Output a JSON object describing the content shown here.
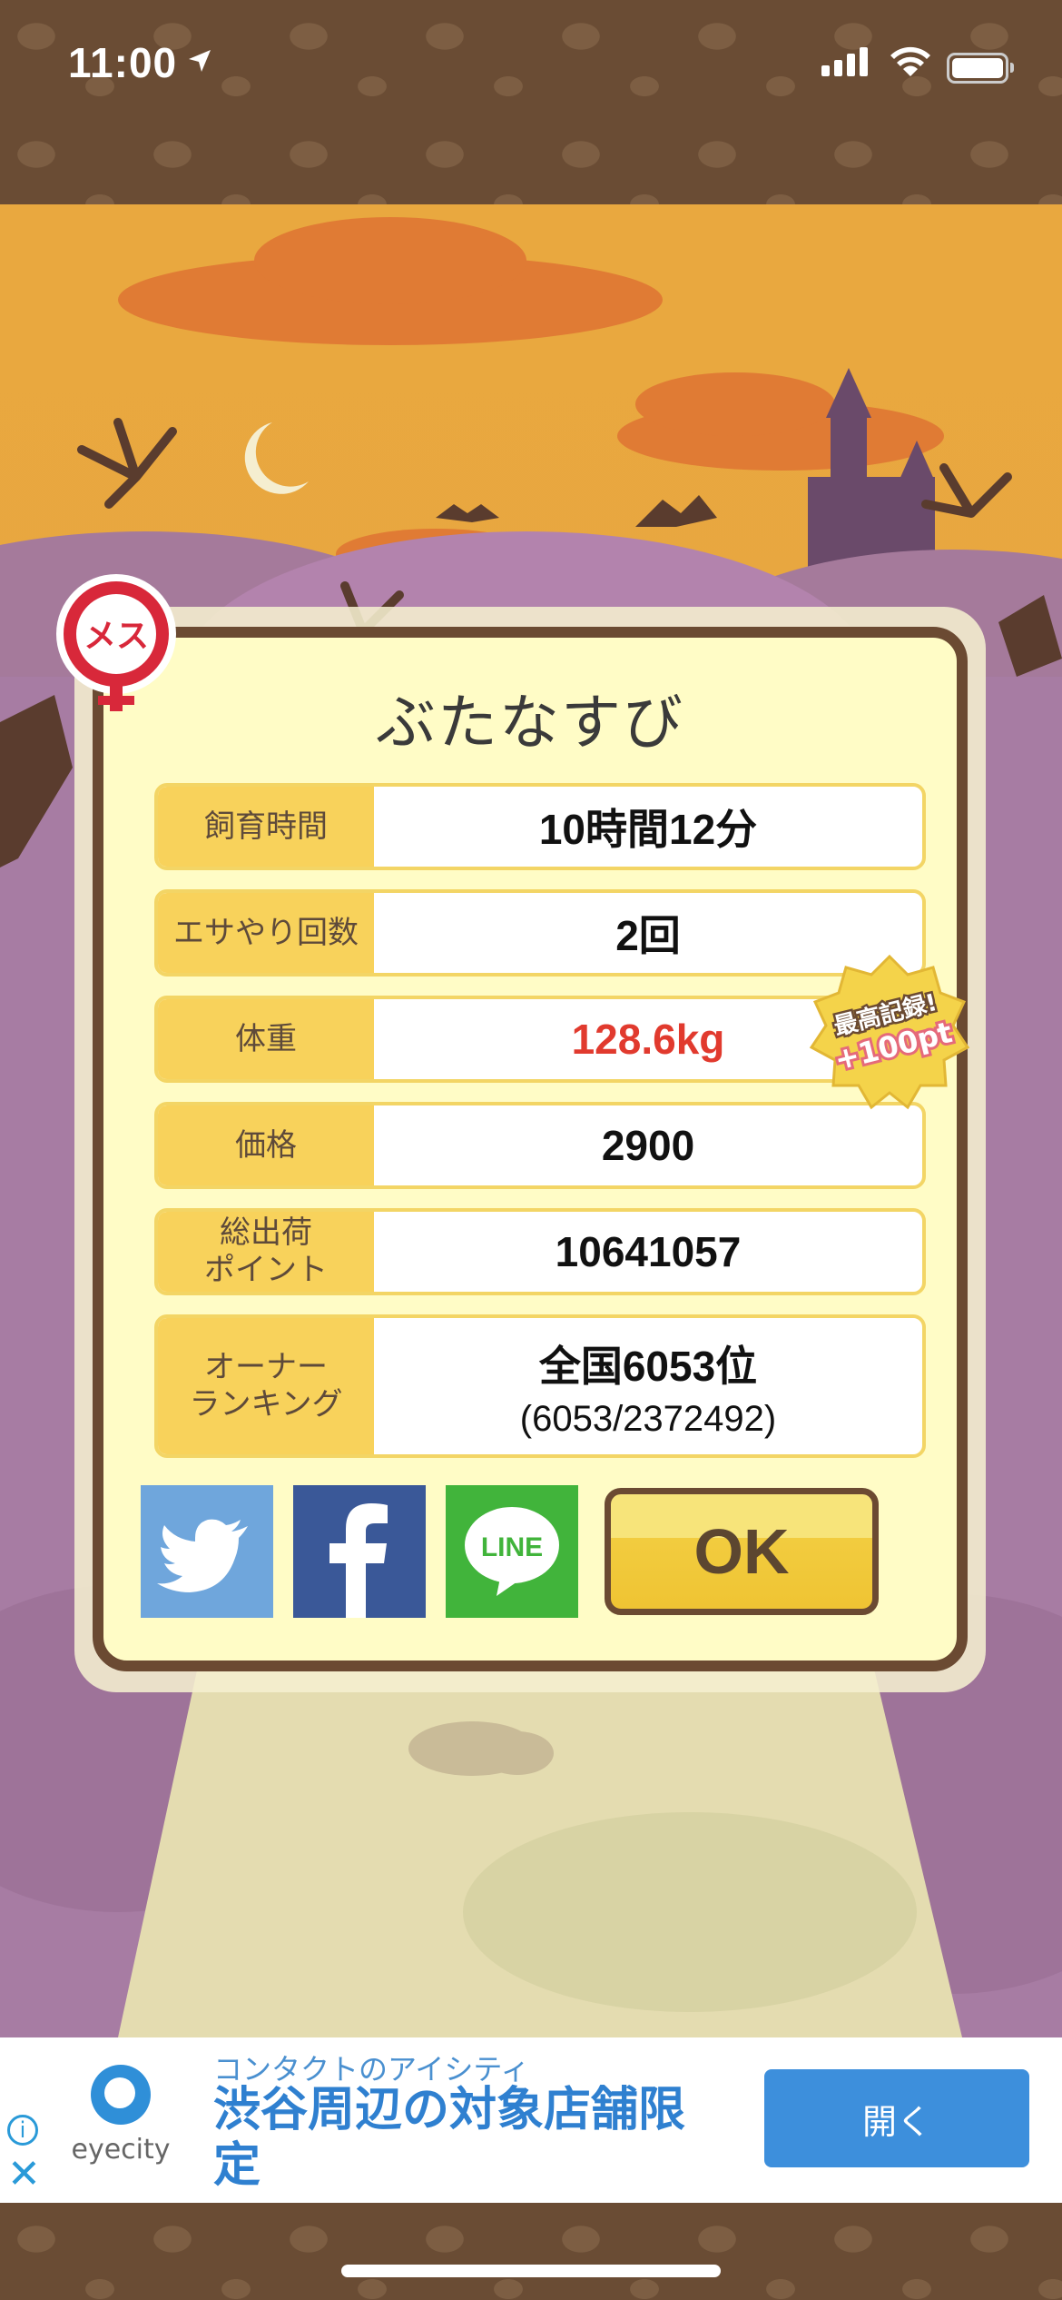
{
  "status_bar": {
    "time": "11:00"
  },
  "panel": {
    "pet_name": "ぶたなすび",
    "gender_badge": "メス",
    "rows": [
      {
        "label": "飼育時間",
        "value": "10時間12分"
      },
      {
        "label": "エサやり回数",
        "value": "2回"
      },
      {
        "label": "体重",
        "value": "128.6kg"
      },
      {
        "label": "価格",
        "value": "2900"
      },
      {
        "label": "総出荷\nポイント",
        "value": "10641057"
      },
      {
        "label": "オーナー\nランキング",
        "value": "全国6053位",
        "sub": "(6053/2372492)"
      }
    ],
    "record_badge": {
      "line1": "最高記録!",
      "line2": "+100pt"
    },
    "share": [
      "twitter-icon",
      "facebook-icon",
      "line-icon"
    ],
    "line_text": "LINE",
    "ok_label": "OK"
  },
  "ad": {
    "brand": "eyecity",
    "advertiser": "コンタクトのアイシティ",
    "headline": "渋谷周辺の対象店舗限定",
    "button": "開く"
  },
  "colors": {
    "accent": "#f8d25b",
    "panel": "#fffcc6",
    "frame": "#6b4a32",
    "weight_text": "#e13a2e"
  }
}
